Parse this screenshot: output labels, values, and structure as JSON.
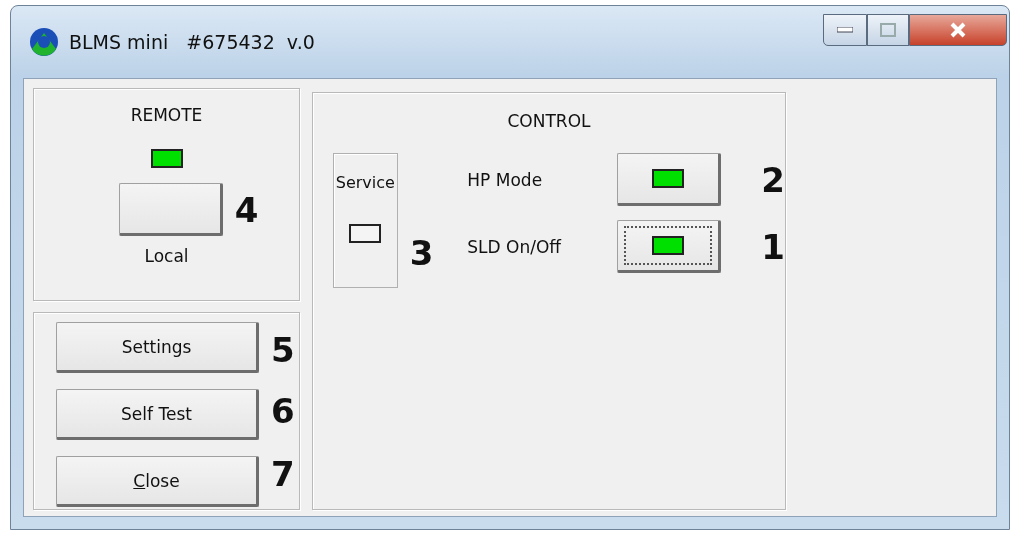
{
  "window": {
    "title": "BLMS mini   #675432  v.0"
  },
  "remote": {
    "title": "REMOTE",
    "indicator": {
      "lit": true
    },
    "button": {
      "annotation": "4"
    },
    "caption": "Local"
  },
  "actions": [
    {
      "label": "Settings",
      "mnemonic": false,
      "annotation": "5"
    },
    {
      "label": "Self Test",
      "mnemonic": false,
      "annotation": "6"
    },
    {
      "label": "Close",
      "mnemonic": true,
      "annotation": "7"
    }
  ],
  "control": {
    "title": "CONTROL",
    "service": {
      "label": "Service",
      "indicator": {
        "lit": false
      },
      "annotation": "3"
    },
    "rows": [
      {
        "label": "HP Mode",
        "indicator": {
          "lit": true
        },
        "focused": false,
        "annotation": "2"
      },
      {
        "label": "SLD On/Off",
        "indicator": {
          "lit": true
        },
        "focused": true,
        "annotation": "1"
      }
    ]
  }
}
